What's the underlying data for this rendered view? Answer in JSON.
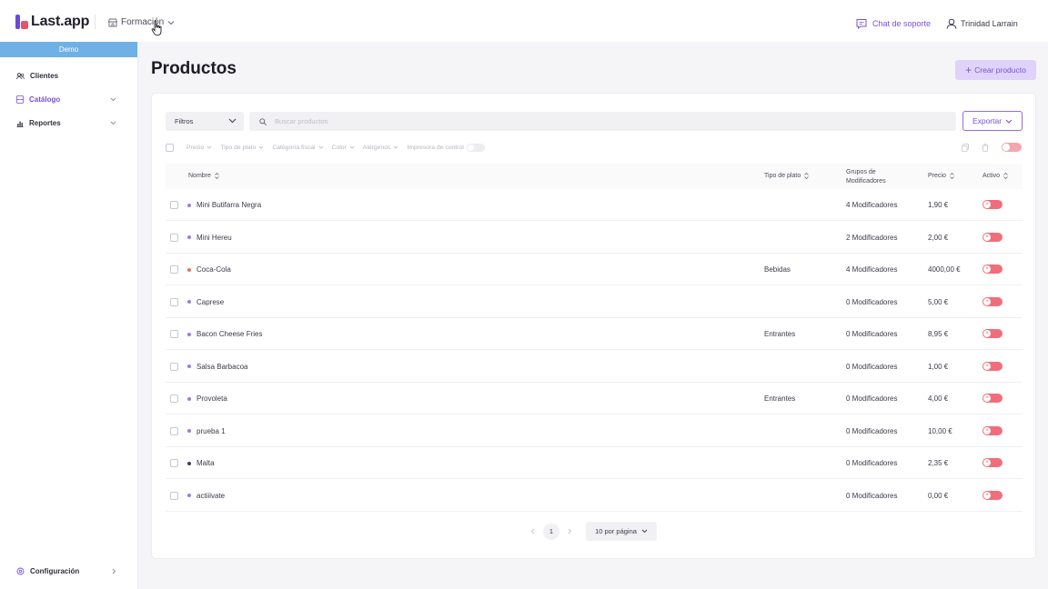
{
  "app": {
    "brand": "Last.app",
    "location": "Formación",
    "support_label": "Chat de soporte",
    "user_name": "Trinidad Larrain"
  },
  "sidebar": {
    "badge": "Demo",
    "items": [
      {
        "label": "Clientes",
        "icon": "users-icon"
      },
      {
        "label": "Catálogo",
        "icon": "catalog-icon"
      },
      {
        "label": "Reportes",
        "icon": "chart-icon"
      }
    ],
    "settings_label": "Configuración"
  },
  "page": {
    "title": "Productos",
    "create_label": "Crear producto"
  },
  "toolbar": {
    "filters_label": "Filtros",
    "search_placeholder": "Buscar productos",
    "export_label": "Exportar"
  },
  "chips": [
    "Precio",
    "Tipo de plato",
    "Categoría fiscal",
    "Color",
    "Alérgenos"
  ],
  "printer_label": "Impresora de control",
  "table": {
    "headers": {
      "name": "Nombre",
      "plate": "Tipo de plato",
      "mods_line1": "Grupos de",
      "mods_line2": "Modificadores",
      "price": "Precio",
      "active": "Activo"
    },
    "rows": [
      {
        "name": "Mini Butifarra Negra",
        "plate": "",
        "mods": "4 Modificadores",
        "price": "1,90 €",
        "color": "#9b7be6"
      },
      {
        "name": "Mini Hereu",
        "plate": "",
        "mods": "2 Modificadores",
        "price": "2,00 €",
        "color": "#9b7be6"
      },
      {
        "name": "Coca-Cola",
        "plate": "Bebidas",
        "mods": "4 Modificadores",
        "price": "4000,00 €",
        "color": "#e8735a"
      },
      {
        "name": "Caprese",
        "plate": "",
        "mods": "0 Modificadores",
        "price": "5,00 €",
        "color": "#9b7be6"
      },
      {
        "name": "Bacon Cheese Fries",
        "plate": "Entrantes",
        "mods": "0 Modificadores",
        "price": "8,95 €",
        "color": "#9b7be6"
      },
      {
        "name": "Salsa Barbacoa",
        "plate": "",
        "mods": "0 Modificadores",
        "price": "1,00 €",
        "color": "#9b7be6"
      },
      {
        "name": "Provoleta",
        "plate": "Entrantes",
        "mods": "0 Modificadores",
        "price": "4,00 €",
        "color": "#9b7be6"
      },
      {
        "name": "prueba 1",
        "plate": "",
        "mods": "0 Modificadores",
        "price": "10,00 €",
        "color": "#9b7be6"
      },
      {
        "name": "Malta",
        "plate": "",
        "mods": "0 Modificadores",
        "price": "2,35 €",
        "color": "#3d3d5c"
      },
      {
        "name": "actiiivate",
        "plate": "",
        "mods": "0 Modificadores",
        "price": "0,00 €",
        "color": "#9b7be6"
      }
    ]
  },
  "pagination": {
    "current_page": "1",
    "per_page": "10 por página"
  },
  "colors": {
    "accent": "#7b4fd6",
    "toggle_off": "#f06e7b",
    "demo_bar": "#6fb1e6"
  }
}
